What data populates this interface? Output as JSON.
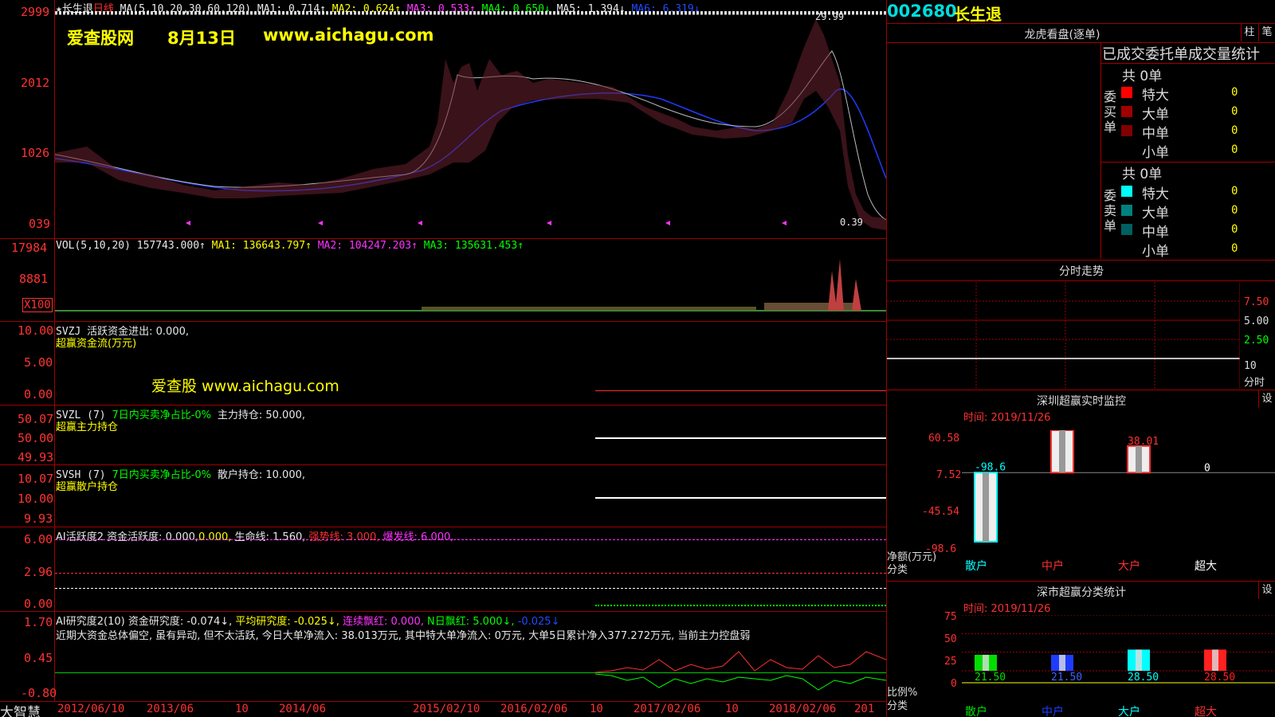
{
  "stock": {
    "code": "002680",
    "name": "长生退"
  },
  "main_chart": {
    "header": {
      "star_name": "★长生退",
      "period": "日线",
      "ma_spec": "MA(5,10,20,30,60,120)",
      "ma1": "MA1: 0.714↑",
      "ma2": "MA2: 0.624↑",
      "ma3": "MA3: 0.533↑",
      "ma4": "MA4: 0.650↓",
      "ma5": "MA5: 1.394↓",
      "ma6": "MA6: 6.319↓"
    },
    "y_labels": [
      "2999",
      "2012",
      "1026",
      "039"
    ],
    "high_label": "29.99",
    "low_label": "0.39",
    "watermark": {
      "site": "爱查股网",
      "date": "8月13日",
      "url": "www.aichagu.com"
    }
  },
  "volume": {
    "header": {
      "spec": "VOL(5,10,20)",
      "value": "157743.000↑",
      "ma1": "MA1: 136643.797↑",
      "ma2": "MA2: 104247.203↑",
      "ma3": "MA3: 135631.453↑"
    },
    "y_labels": [
      "17984",
      "8881"
    ],
    "unit": "X100"
  },
  "svzj": {
    "title": "SVZJ",
    "label": "活跃资金进出: 0.000,",
    "subtitle": "超赢资金流(万元)",
    "y_labels": [
      "10.00",
      "5.00",
      "0.00"
    ],
    "watermark": "爱查股 www.aichagu.com"
  },
  "svzl": {
    "title": "SVZL (7)",
    "green_text": "7日内买卖净占比-0%",
    "white_text": "主力持仓: 50.000,",
    "subtitle": "超赢主力持仓",
    "y_labels": [
      "50.07",
      "50.00",
      "49.93"
    ]
  },
  "svsh": {
    "title": "SVSH (7)",
    "green_text": "7日内买卖净占比-0%",
    "white_text": "散户持仓: 10.000,",
    "subtitle": "超赢散户持仓",
    "y_labels": [
      "10.07",
      "10.00",
      "9.93"
    ]
  },
  "ai_active": {
    "title": "AI活跃度2",
    "t1": "资金活跃度: 0.000,",
    "t2": "0.000,",
    "t3": "生命线: 1.560,",
    "t4": "强势线: 3.000,",
    "t5": "爆发线: 6.000,",
    "y_labels": [
      "6.00",
      "2.96",
      "0.00"
    ]
  },
  "ai_research": {
    "title": "AI研究度2(10)",
    "t1": "资金研究度: -0.074↓,",
    "t2": "平均研究度: -0.025↓,",
    "t3": "连续飘红: 0.000,",
    "t4": "N日飘红: 5.000↓,",
    "t5": "-0.025↓",
    "comment": "近期大资金总体偏空, 虽有异动, 但不太活跃, 今日大单净流入: 38.013万元, 其中特大单净流入: 0万元, 大单5日累计净入377.272万元, 当前主力控盘弱",
    "y_labels": [
      "1.70",
      "0.45",
      "-0.80"
    ]
  },
  "x_axis": [
    "2012/06/10",
    "2013/06",
    "10",
    "2014/06",
    "2015/02/10",
    "2016/02/06",
    "10",
    "2017/02/06",
    "10",
    "2018/02/06",
    "201"
  ],
  "brand": "大智慧",
  "right": {
    "longhu": {
      "title": "龙虎看盘(逐单)",
      "btn_col": "柱",
      "btn_pen": "笔",
      "tabs": "已成交委托单成交量统计",
      "buy_side": "委买单",
      "sell_side": "委卖单",
      "buy_total": "共 0单",
      "sell_total": "共 0单",
      "buy_rows": [
        {
          "label": "特大",
          "value": "0"
        },
        {
          "label": "大单",
          "value": "0"
        },
        {
          "label": "中单",
          "value": "0"
        },
        {
          "label": "小单",
          "value": "0"
        }
      ],
      "sell_rows": [
        {
          "label": "特大",
          "value": "0"
        },
        {
          "label": "大单",
          "value": "0"
        },
        {
          "label": "中单",
          "value": "0"
        },
        {
          "label": "小单",
          "value": "0"
        }
      ],
      "colors": {
        "buy": [
          "#ff0000",
          "#a00000",
          "#800000",
          "#000000"
        ],
        "sell": [
          "#00ffff",
          "#008080",
          "#006060",
          "#000000"
        ]
      }
    },
    "fenshi": {
      "title": "分时走势",
      "y_labels": [
        "7.50",
        "5.00",
        "2.50",
        "10"
      ],
      "unit": "分时"
    },
    "monitor": {
      "title": "深圳超赢实时监控",
      "btn": "设",
      "time_label": "时间: 2019/11/26",
      "y_labels": [
        "60.58",
        "7.52",
        "-45.54",
        "-98.6"
      ],
      "unit_label": "净额(万元)",
      "category_label": "分类",
      "categories": [
        "散户",
        "中户",
        "大户",
        "超大"
      ],
      "values": [
        -98.6,
        60.58,
        38.01,
        0
      ],
      "value_labels": [
        "-98.6",
        "60.58",
        "38.01",
        "0"
      ]
    },
    "classify": {
      "title": "深市超赢分类统计",
      "btn": "设",
      "time_label": "时间: 2019/11/26",
      "y_labels": [
        "75",
        "50",
        "25",
        "0"
      ],
      "unit_label": "比例%",
      "category_label": "分类",
      "categories": [
        "散户",
        "中户",
        "大户",
        "超大"
      ],
      "values": [
        21.5,
        21.5,
        28.5,
        28.5
      ],
      "value_labels": [
        "21.50",
        "21.50",
        "28.50",
        "28.50"
      ],
      "colors": [
        "#00dd00",
        "#1e3cff",
        "#00ffff",
        "#ff2020"
      ]
    }
  }
}
